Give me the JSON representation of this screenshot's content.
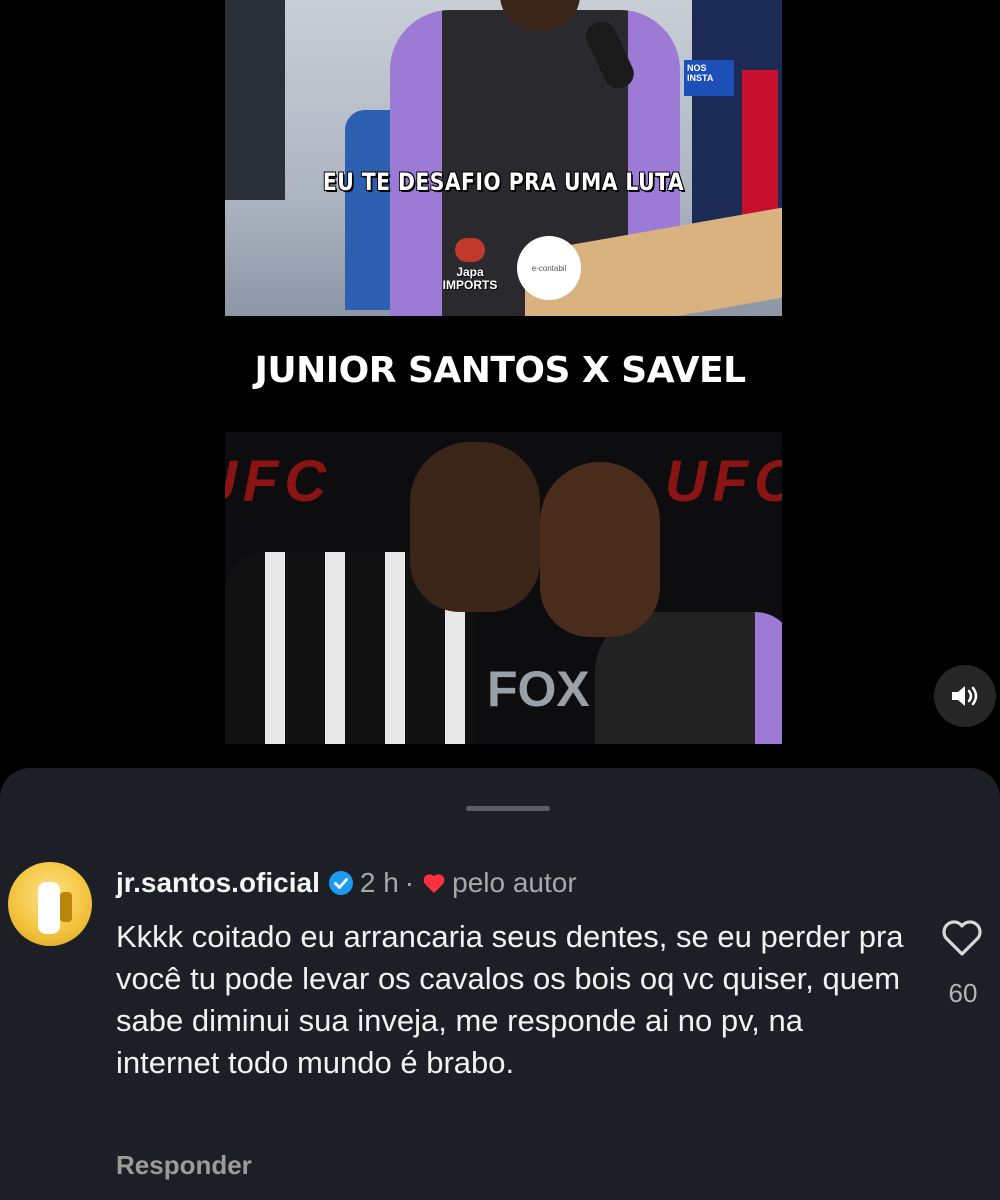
{
  "post": {
    "top_caption": "EU TE DESAFIO PRA UMA LUTA",
    "sponsor_left": "Japa IMPORTS",
    "sponsor_right": "e-contabil",
    "headline": "JUNIOR SANTOS X SAVEL",
    "bottom_logo_left": "UFC",
    "bottom_logo_right": "UFC",
    "fox_logo": "FOX",
    "store_sign": "NOS INSTA"
  },
  "comment": {
    "username": "jr.santos.oficial",
    "verified": true,
    "time": "2 h",
    "separator": "·",
    "by_author": "pelo autor",
    "text": "Kkkk coitado eu arrancaria  seus dentes, se eu perder pra você tu pode levar os cavalos os bois oq vc quiser, quem sabe diminui sua inveja, me responde ai no pv, na internet todo mundo é brabo.",
    "reply_label": "Responder",
    "like_count": "60"
  },
  "icons": {
    "audio": "speaker-icon",
    "like": "heart-outline-icon",
    "author_liked": "heart-filled-icon",
    "verified": "verified-badge-icon"
  },
  "colors": {
    "sheet_background": "#1c1f26",
    "verified_blue": "#1d9bf0",
    "liked_red": "#ff3040"
  }
}
